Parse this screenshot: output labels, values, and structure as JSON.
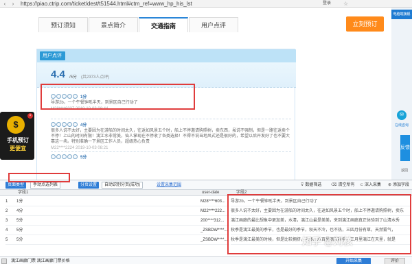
{
  "browser": {
    "url": "https://piao.ctrip.com/ticket/dest/t51544.html#ctm_ref=www_hp_his_lst",
    "login": "登录"
  },
  "tabs": [
    {
      "label": "预订须知"
    },
    {
      "label": "景点简介"
    },
    {
      "label": "交通指南"
    },
    {
      "label": "用户点评"
    }
  ],
  "book_button": "立刻预订",
  "comments": {
    "header_label": "用户点评",
    "score": "4.4",
    "score_unit": "/5分",
    "score_count": "(共2373人点评)",
    "reviews": [
      {
        "score": "1分",
        "text": "导游2b，一个午餐钟吼半天，到景区自己行动了",
        "meta": "M28****6037   2019-10-03 08:44"
      },
      {
        "score": "4分",
        "text": "很多人说不太好，主要因为在游船的时间太久，往返如风景五个时，船上不停邀请购照树，卖东西，虽说不强制，但是一路往返卖个不停！上山的时间有限！漓江水非常美，仙人掌现在不停收了各类选择！不得不说当地风式还是很好的，希望以后开发好了也不要大靠这一块。特别准确一下景区工作人员，超级热心负责",
        "meta": "M22****2224   2019-10-03 08:21"
      },
      {
        "score": "5分",
        "text": "",
        "meta": ""
      }
    ]
  },
  "promo": {
    "line1": "手机预订",
    "line2": "更便宜",
    "close": "×"
  },
  "right_strip": {
    "top_label": "电脑端旗舰",
    "circle_label": "在线咨询",
    "box_label": "反馈",
    "arrow_label": "返回"
  },
  "scraper": {
    "page_type_tag": "页面类型",
    "page_type_value": "手动点选列表",
    "paging_tag": "分页设置",
    "paging_value": "自动识别分页(成功)",
    "paging_link": "设置采集范围",
    "actions": [
      {
        "icon": "filter-icon",
        "glyph": "⊽",
        "label": "数据筛选"
      },
      {
        "icon": "trash-icon",
        "glyph": "🗑",
        "label": "清空所有"
      },
      {
        "icon": "deepcollect-icon",
        "glyph": "⊂",
        "label": "深入采集"
      },
      {
        "icon": "addfield-icon",
        "glyph": "⊕",
        "label": "添加字段"
      }
    ],
    "columns": [
      "字段1",
      "user-date",
      "字段2"
    ],
    "rows": [
      {
        "n": "1",
        "c1": "1分",
        "c2": "M28****603...",
        "c3": "导游2b，一个午餐钟吼半天，到景区自己行动了"
      },
      {
        "n": "2",
        "c1": "4分",
        "c2": "M22****222...",
        "c3": "很多人说不太好，主要因为在游船的时间太久，往返如风景五个时，船上不停邀请购照树，卖东"
      },
      {
        "n": "3",
        "c1": "5分",
        "c2": "200****312...",
        "c3": "漓江画廊的最比想象中更加美，水清，漓江山最是美美，来到漓江画廊真正体验到了山清水秀"
      },
      {
        "n": "4",
        "c1": "5分",
        "c2": "_ZSBDW****...",
        "c3": "秋季是漓江最美的季节，也是最好的季节，秋天不冷，也不热，三四月份有草，天然雾气，"
      },
      {
        "n": "5",
        "c1": "5分",
        "c2": "_ZSBDW****...",
        "c3": "秋季是漓江最美的时候，但是比较拥挤，人多。八百里漓江秋季，三月里漓江在天里，就是"
      }
    ],
    "path_text": "漓江画廊门票 漓江画廊门票价格",
    "run_button": "开始采集",
    "stop_button": "评价"
  },
  "watermark": "知乎 @刘核"
}
